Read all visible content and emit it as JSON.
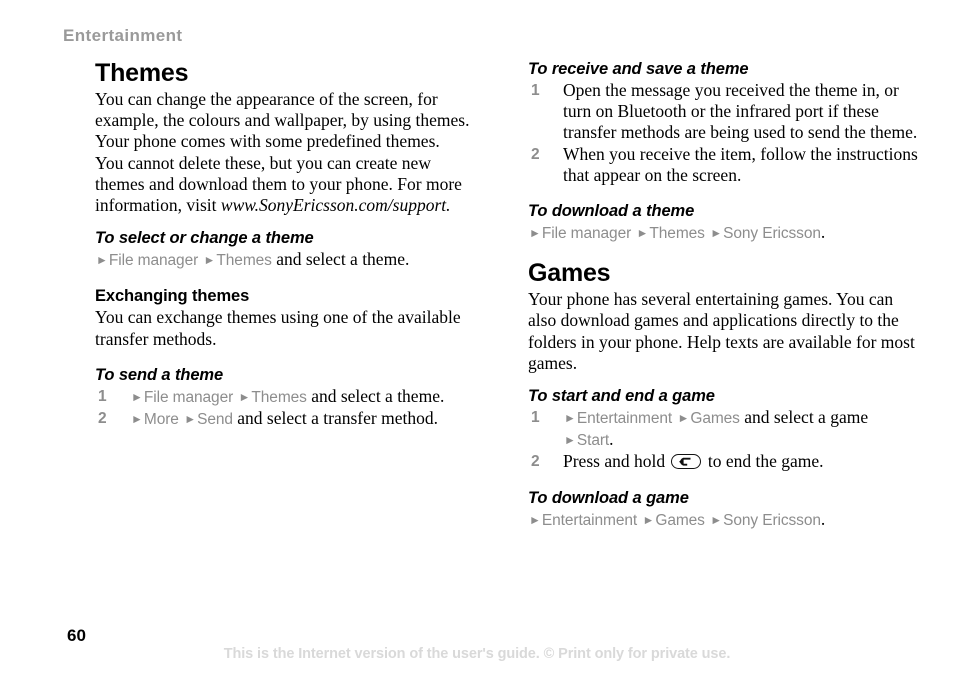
{
  "header": {
    "running_head": "Entertainment"
  },
  "footer": {
    "page_number": "60",
    "note": "This is the Internet version of the user's guide. © Print only for private use."
  },
  "colors": {
    "running_head": "#9a9a9a",
    "menu_path": "#8d8d8d",
    "footer_note": "#d9d9d9",
    "body_text": "#000000"
  },
  "left_column": {
    "themes": {
      "title": "Themes",
      "intro": "You can change the appearance of the screen, for example, the colours and wallpaper, by using themes. Your phone comes with some predefined themes. You cannot delete these, but you can create new themes and download them to your phone. For more information, visit ",
      "intro_url": "www.SonyEricsson.com/support",
      "intro_end": "."
    },
    "select_change": {
      "heading": "To select or change a theme",
      "path": [
        "File manager",
        "Themes"
      ],
      "tail": " and select a theme."
    },
    "exchanging": {
      "heading": "Exchanging themes",
      "body": "You can exchange themes using one of the available transfer methods."
    },
    "send_theme": {
      "heading": "To send a theme",
      "steps": [
        {
          "num": "1",
          "path": [
            "File manager",
            "Themes"
          ],
          "tail": " and select a theme."
        },
        {
          "num": "2",
          "path": [
            "More",
            "Send"
          ],
          "tail": " and select a transfer method."
        }
      ]
    }
  },
  "right_column": {
    "receive_save": {
      "heading": "To receive and save a theme",
      "steps": [
        {
          "num": "1",
          "text": "Open the message you received the theme in, or turn on Bluetooth or the infrared port if these transfer methods are being used to send the theme."
        },
        {
          "num": "2",
          "text": "When you receive the item, follow the instructions that appear on the screen."
        }
      ]
    },
    "download_theme": {
      "heading": "To download a theme",
      "path": [
        "File manager",
        "Themes",
        "Sony Ericsson"
      ],
      "tail": "."
    },
    "games": {
      "title": "Games",
      "intro": "Your phone has several entertaining games. You can also download games and applications directly to the folders in your phone. Help texts are available for most games."
    },
    "start_end_game": {
      "heading": "To start and end a game",
      "step1": {
        "num": "1",
        "path": [
          "Entertainment",
          "Games"
        ],
        "tail": " and select a game",
        "cont_path": [
          "Start"
        ],
        "cont_tail": "."
      },
      "step2": {
        "num": "2",
        "text_before": "Press and hold ",
        "key_icon": "back-key-icon",
        "text_after": " to end the game."
      }
    },
    "download_game": {
      "heading": "To download a game",
      "path": [
        "Entertainment",
        "Games",
        "Sony Ericsson"
      ],
      "tail": "."
    }
  }
}
